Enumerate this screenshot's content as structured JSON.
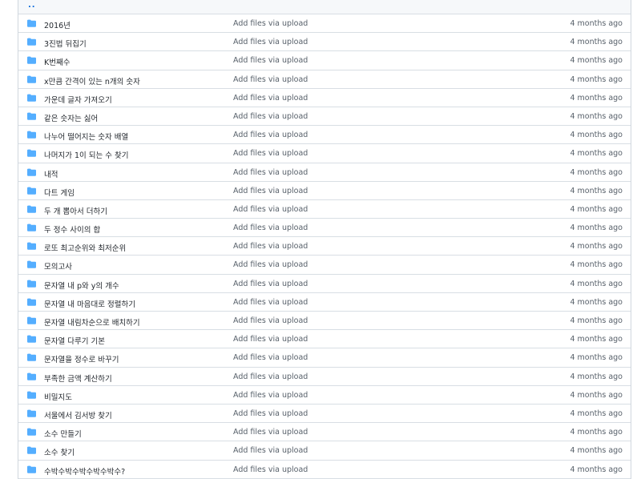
{
  "parent": {
    "label": ".."
  },
  "colors": {
    "folder": "#54aeff",
    "link": "#0969da",
    "muted": "#57606a",
    "border": "#d8dee4"
  },
  "rows": [
    {
      "name": "2016년",
      "message": "Add files via upload",
      "age": "4 months ago",
      "icon": "folder-icon"
    },
    {
      "name": "3진법 뒤집기",
      "message": "Add files via upload",
      "age": "4 months ago",
      "icon": "folder-icon"
    },
    {
      "name": "K번째수",
      "message": "Add files via upload",
      "age": "4 months ago",
      "icon": "folder-icon"
    },
    {
      "name": "x만큼 간격이 있는 n개의 숫자",
      "message": "Add files via upload",
      "age": "4 months ago",
      "icon": "folder-icon"
    },
    {
      "name": "가운데 글자 가져오기",
      "message": "Add files via upload",
      "age": "4 months ago",
      "icon": "folder-icon"
    },
    {
      "name": "같은 숫자는 싫어",
      "message": "Add files via upload",
      "age": "4 months ago",
      "icon": "folder-icon"
    },
    {
      "name": "나누어 떨어지는 숫자 배열",
      "message": "Add files via upload",
      "age": "4 months ago",
      "icon": "folder-icon"
    },
    {
      "name": "나머지가 1이 되는 수 찾기",
      "message": "Add files via upload",
      "age": "4 months ago",
      "icon": "folder-icon"
    },
    {
      "name": "내적",
      "message": "Add files via upload",
      "age": "4 months ago",
      "icon": "folder-icon"
    },
    {
      "name": "다트 게임",
      "message": "Add files via upload",
      "age": "4 months ago",
      "icon": "folder-icon"
    },
    {
      "name": "두 개 뽑아서 더하기",
      "message": "Add files via upload",
      "age": "4 months ago",
      "icon": "folder-icon"
    },
    {
      "name": "두 정수 사이의 합",
      "message": "Add files via upload",
      "age": "4 months ago",
      "icon": "folder-icon"
    },
    {
      "name": "로또 최고순위와 최저순위",
      "message": "Add files via upload",
      "age": "4 months ago",
      "icon": "folder-icon"
    },
    {
      "name": "모의고사",
      "message": "Add files via upload",
      "age": "4 months ago",
      "icon": "folder-icon"
    },
    {
      "name": "문자열 내 p와 y의 개수",
      "message": "Add files via upload",
      "age": "4 months ago",
      "icon": "folder-icon"
    },
    {
      "name": "문자열 내 마음대로 정렬하기",
      "message": "Add files via upload",
      "age": "4 months ago",
      "icon": "folder-icon"
    },
    {
      "name": "문자열 내림차순으로 배치하기",
      "message": "Add files via upload",
      "age": "4 months ago",
      "icon": "folder-icon"
    },
    {
      "name": "문자열 다루기 기본",
      "message": "Add files via upload",
      "age": "4 months ago",
      "icon": "folder-icon"
    },
    {
      "name": "문자열을 정수로 바꾸기",
      "message": "Add files via upload",
      "age": "4 months ago",
      "icon": "folder-icon"
    },
    {
      "name": "부족한 금액 계산하기",
      "message": "Add files via upload",
      "age": "4 months ago",
      "icon": "folder-icon"
    },
    {
      "name": "비밀지도",
      "message": "Add files via upload",
      "age": "4 months ago",
      "icon": "folder-icon"
    },
    {
      "name": "서울에서 김서방 찾기",
      "message": "Add files via upload",
      "age": "4 months ago",
      "icon": "folder-icon"
    },
    {
      "name": "소수 만들기",
      "message": "Add files via upload",
      "age": "4 months ago",
      "icon": "folder-icon"
    },
    {
      "name": "소수 찾기",
      "message": "Add files via upload",
      "age": "4 months ago",
      "icon": "folder-icon"
    },
    {
      "name": "수박수박수박수박수박수?",
      "message": "Add files via upload",
      "age": "4 months ago",
      "icon": "folder-icon"
    }
  ]
}
